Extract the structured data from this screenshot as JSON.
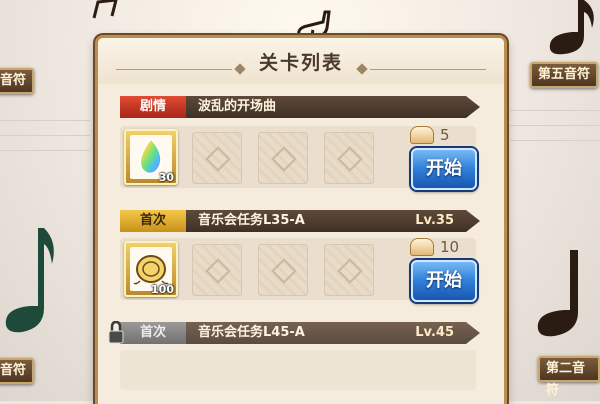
{
  "background": {
    "left_top_tag": "音符",
    "left_bottom_tag": "音符",
    "right_top_tag": "第五音符",
    "right_bottom_tag": "第二音符"
  },
  "panel": {
    "title": "关卡列表"
  },
  "stages": [
    {
      "tag": "剧情",
      "tag_style": "story",
      "name": "波乱的开场曲",
      "level": "",
      "reward_count": "30",
      "reward_icon": "rainbow-crystal-icon",
      "cost": "5",
      "start_label": "开始"
    },
    {
      "tag": "首次",
      "tag_style": "first",
      "name": "音乐会任务L35-A",
      "level": "Lv.35",
      "reward_count": "100",
      "reward_icon": "gold-coin-icon",
      "cost": "10",
      "start_label": "开始"
    },
    {
      "tag": "首次",
      "tag_style": "grey",
      "name": "音乐会任务L45-A",
      "level": "Lv.45",
      "locked": true
    }
  ],
  "colors": {
    "story_tag": "#c8301f",
    "first_tag": "#e0a92e",
    "start_button": "#2f7fd8",
    "panel_border": "#b98e52"
  }
}
